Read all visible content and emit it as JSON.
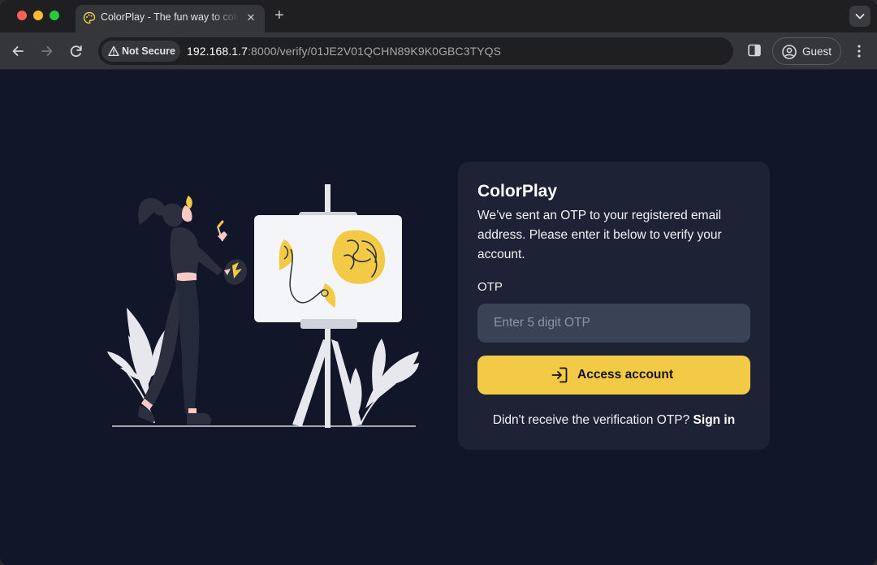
{
  "browser": {
    "tab": {
      "title": "ColorPlay - The fun way to color"
    },
    "security_label": "Not Secure",
    "url_host": "192.168.1.7",
    "url_path": ":8000/verify/01JE2V01QCHN89K9K0GBC3TYQS",
    "profile_label": "Guest"
  },
  "card": {
    "title": "ColorPlay",
    "description": "We’ve sent an OTP to your registered email address. Please enter it below to verify your account.",
    "otp_label": "OTP",
    "otp_value": "",
    "otp_placeholder": "Enter 5 digit OTP",
    "submit_label": "Access account",
    "resend_prefix": "Didn't receive the verification OTP?",
    "signin_label": "Sign in"
  },
  "colors": {
    "page_background": "#121629",
    "card_background": "#1e2235",
    "accent": "#f2ca45",
    "input_background": "#3a4255"
  },
  "icons": {
    "favicon": "palette-icon",
    "back": "arrow-left-icon",
    "forward": "arrow-right-icon",
    "reload": "reload-icon",
    "warning": "warning-icon",
    "side_panel": "side-panel-icon",
    "profile": "person-circle-icon",
    "menu": "kebab-menu-icon",
    "submit": "sign-in-icon"
  }
}
